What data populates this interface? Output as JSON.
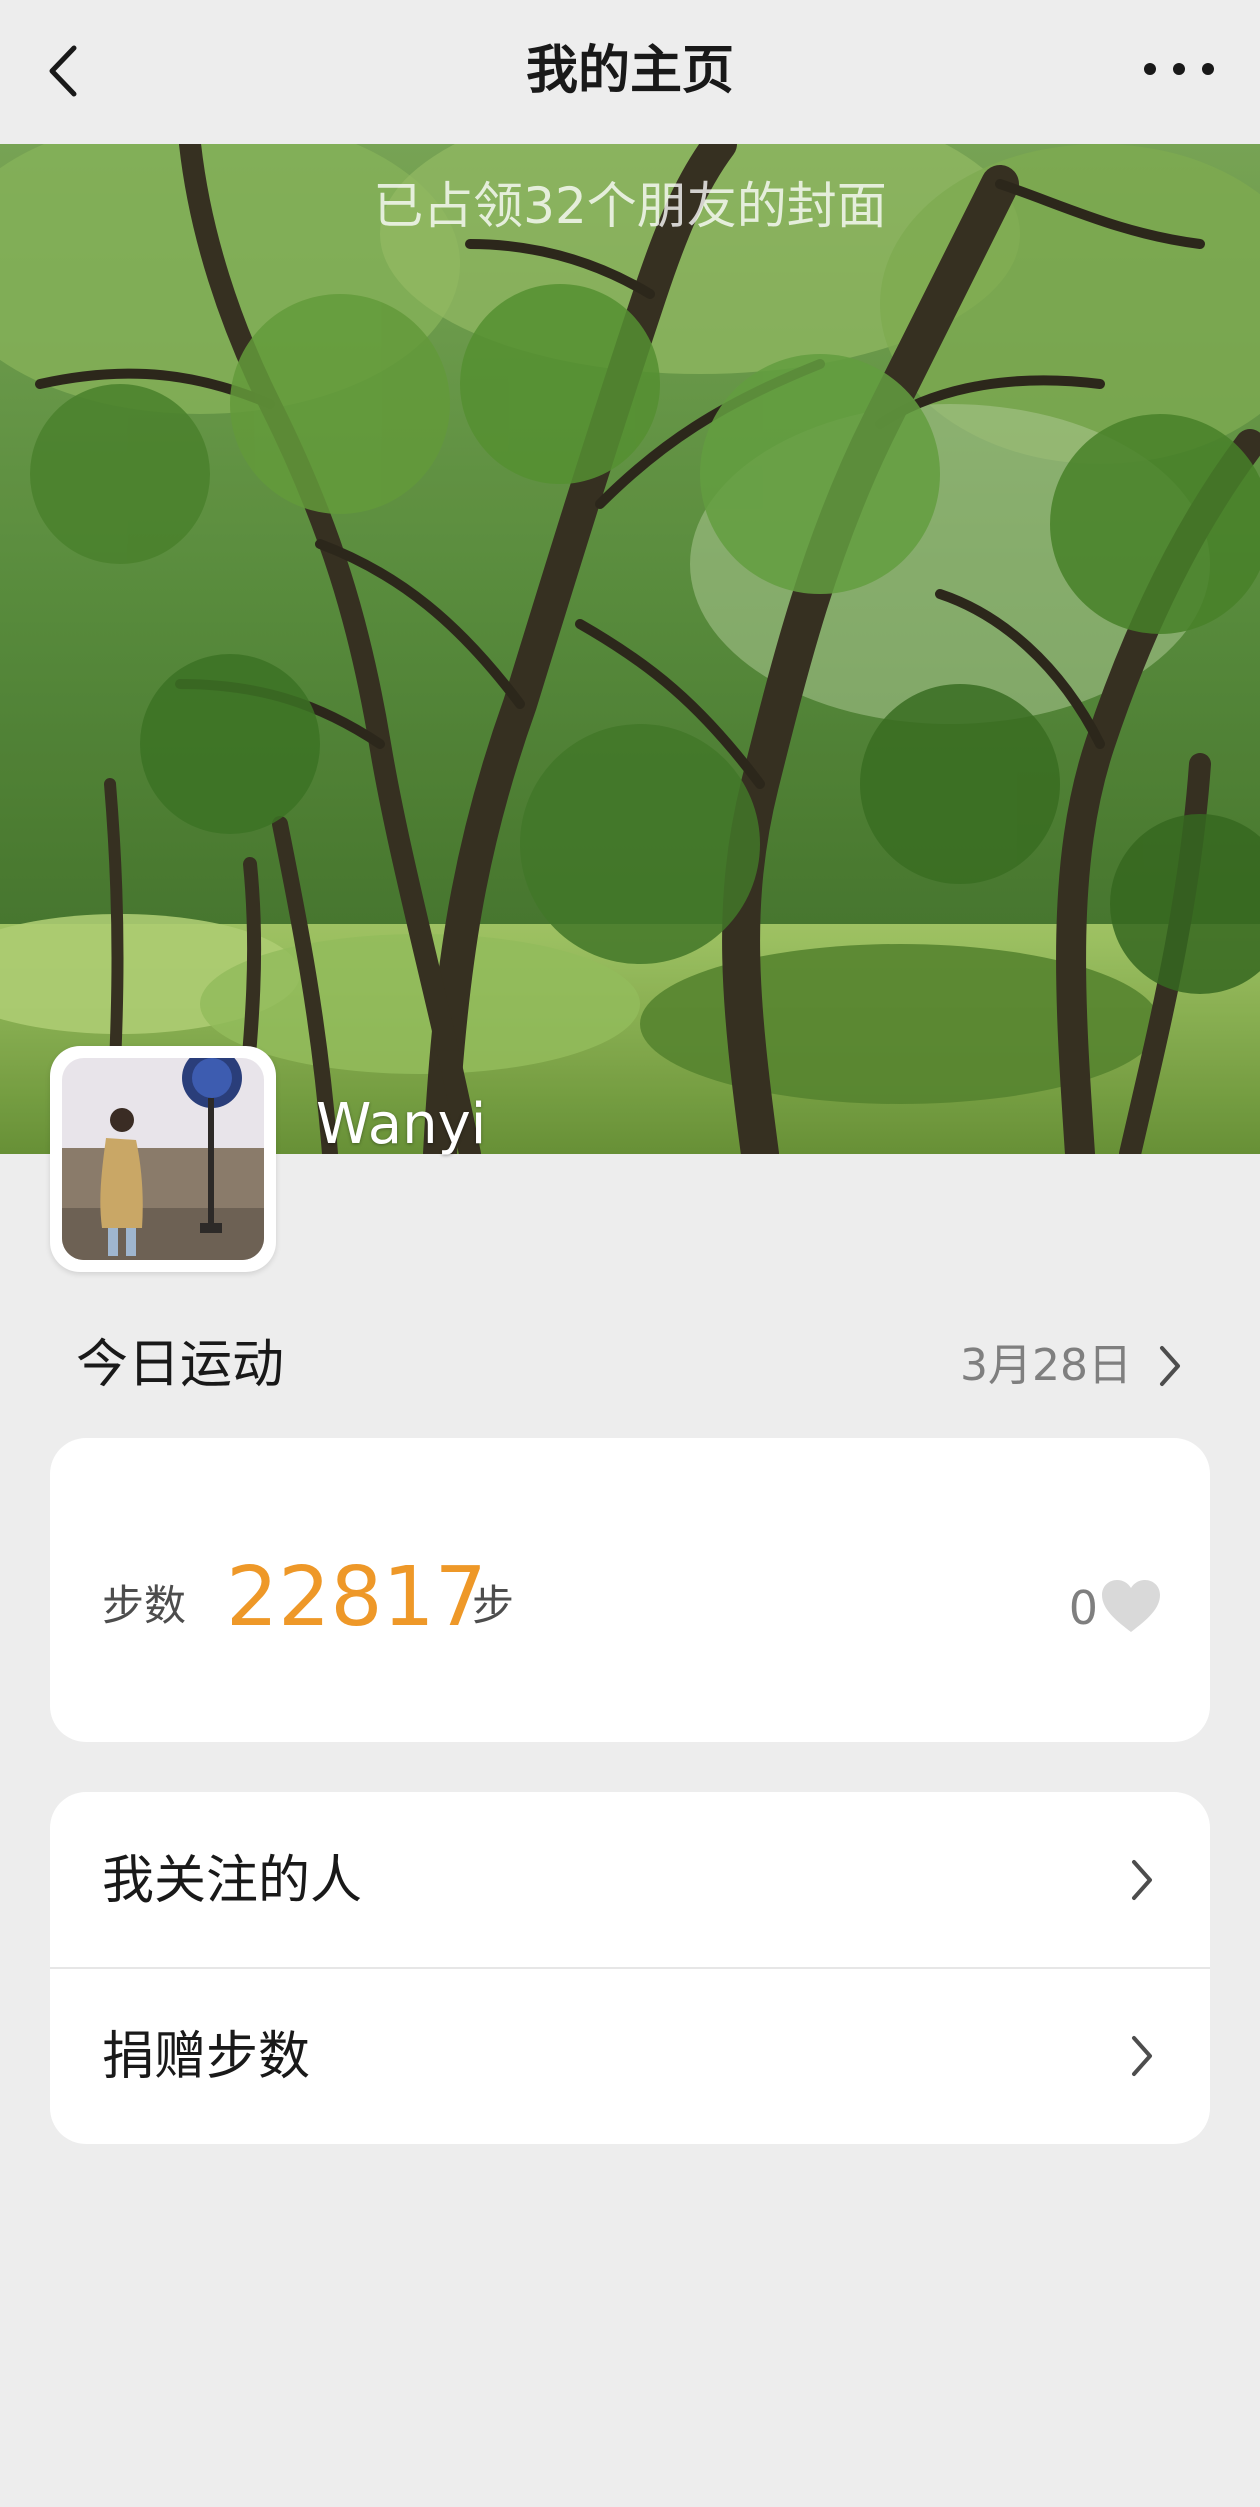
{
  "nav": {
    "title": "我的主页",
    "back_icon": "chevron-left-icon",
    "more_icon": "more-dots-icon"
  },
  "cover": {
    "caption": "已占领32个朋友的封面",
    "username": "Wanyi"
  },
  "today": {
    "title": "今日运动",
    "date": "3月28日",
    "steps_label": "步数",
    "steps_value": "22817",
    "steps_unit": "步",
    "likes": "0",
    "accent_color": "#ee9828"
  },
  "menu": {
    "items": [
      {
        "label": "我关注的人"
      },
      {
        "label": "捐赠步数"
      }
    ]
  }
}
